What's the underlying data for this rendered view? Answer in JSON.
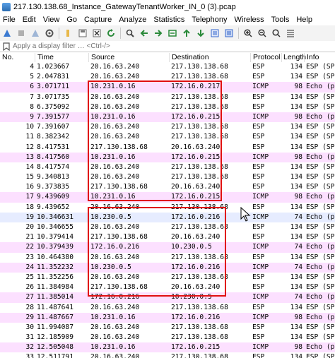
{
  "window": {
    "title": "217.130.138.68_Instance_GatewayTenantWorker_IN_0 (3).pcap"
  },
  "menu": [
    "File",
    "Edit",
    "View",
    "Go",
    "Capture",
    "Analyze",
    "Statistics",
    "Telephony",
    "Wireless",
    "Tools",
    "Help"
  ],
  "toolbar": {
    "icons": [
      "shark-fin-start-icon",
      "stop-icon",
      "restart-icon",
      "options-gear-icon",
      "open-folder-icon",
      "save-icon",
      "close-file-icon",
      "reload-icon",
      "find-icon",
      "back-arrow-icon",
      "forward-arrow-icon",
      "go-to-packet-icon",
      "first-packet-icon",
      "last-packet-icon",
      "autoscroll-icon",
      "colorize-icon",
      "zoom-in-icon",
      "zoom-out-icon",
      "normal-size-icon",
      "resize-columns-icon"
    ]
  },
  "filter": {
    "placeholder": "Apply a display filter … <Ctrl-/>"
  },
  "columns": {
    "no": "No.",
    "time": "Time",
    "source": "Source",
    "destination": "Destination",
    "protocol": "Protocol",
    "length": "Length",
    "info": "Info"
  },
  "colors": {
    "esp_row": "#ffffff",
    "icmp_row": "#fce0ff",
    "selected_row": "#e6ecff",
    "highlight_box": "#e01010"
  },
  "packets": [
    {
      "no": "4",
      "time": "1.023667",
      "src": "20.16.63.240",
      "dst": "217.130.138.68",
      "proto": "ESP",
      "len": "134",
      "info": "ESP (SPI",
      "kind": "esp"
    },
    {
      "no": "5",
      "time": "2.047831",
      "src": "20.16.63.240",
      "dst": "217.130.138.68",
      "proto": "ESP",
      "len": "134",
      "info": "ESP (SPI",
      "kind": "esp"
    },
    {
      "no": "6",
      "time": "3.071711",
      "src": "10.231.0.16",
      "dst": "172.16.0.217",
      "proto": "ICMP",
      "len": "98",
      "info": "Echo (p",
      "kind": "icmp"
    },
    {
      "no": "7",
      "time": "3.071735",
      "src": "20.16.63.240",
      "dst": "217.130.138.68",
      "proto": "ESP",
      "len": "134",
      "info": "ESP (SP",
      "kind": "esp"
    },
    {
      "no": "8",
      "time": "6.375092",
      "src": "20.16.63.240",
      "dst": "217.130.138.68",
      "proto": "ESP",
      "len": "134",
      "info": "ESP (SP",
      "kind": "esp"
    },
    {
      "no": "9",
      "time": "7.391577",
      "src": "10.231.0.16",
      "dst": "172.16.0.215",
      "proto": "ICMP",
      "len": "98",
      "info": "Echo (p",
      "kind": "icmp"
    },
    {
      "no": "10",
      "time": "7.391607",
      "src": "20.16.63.240",
      "dst": "217.130.138.68",
      "proto": "ESP",
      "len": "134",
      "info": "ESP (SP",
      "kind": "esp"
    },
    {
      "no": "11",
      "time": "8.382342",
      "src": "20.16.63.240",
      "dst": "217.130.138.68",
      "proto": "ESP",
      "len": "134",
      "info": "ESP (SP",
      "kind": "esp"
    },
    {
      "no": "12",
      "time": "8.417531",
      "src": "217.130.138.68",
      "dst": "20.16.63.240",
      "proto": "ESP",
      "len": "134",
      "info": "ESP (SP",
      "kind": "esp"
    },
    {
      "no": "13",
      "time": "8.417560",
      "src": "10.231.0.16",
      "dst": "172.16.0.215",
      "proto": "ICMP",
      "len": "98",
      "info": "Echo (p",
      "kind": "icmp"
    },
    {
      "no": "14",
      "time": "8.417574",
      "src": "20.16.63.240",
      "dst": "217.130.138.68",
      "proto": "ESP",
      "len": "134",
      "info": "ESP (SP",
      "kind": "esp"
    },
    {
      "no": "15",
      "time": "9.340813",
      "src": "20.16.63.240",
      "dst": "217.130.138.68",
      "proto": "ESP",
      "len": "134",
      "info": "ESP (SP",
      "kind": "esp"
    },
    {
      "no": "16",
      "time": "9.373835",
      "src": "217.130.138.68",
      "dst": "20.16.63.240",
      "proto": "ESP",
      "len": "134",
      "info": "ESP (SP",
      "kind": "esp"
    },
    {
      "no": "17",
      "time": "9.439609",
      "src": "10.231.0.16",
      "dst": "172.16.0.215",
      "proto": "ICMP",
      "len": "98",
      "info": "Echo (p",
      "kind": "icmp"
    },
    {
      "no": "18",
      "time": "9.439652",
      "src": "20.16.63.240",
      "dst": "217.130.138.68",
      "proto": "ESP",
      "len": "134",
      "info": "ESP (SP",
      "kind": "esp"
    },
    {
      "no": "19",
      "time": "10.346631",
      "src": "10.230.0.5",
      "dst": "172.16.0.216",
      "proto": "ICMP",
      "len": "74",
      "info": "Echo (p",
      "kind": "sel"
    },
    {
      "no": "20",
      "time": "10.346655",
      "src": "20.16.63.240",
      "dst": "217.130.138.68",
      "proto": "ESP",
      "len": "134",
      "info": "ESP (SP",
      "kind": "esp"
    },
    {
      "no": "21",
      "time": "10.379414",
      "src": "217.130.138.68",
      "dst": "20.16.63.240",
      "proto": "ESP",
      "len": "134",
      "info": "ESP (SP",
      "kind": "esp"
    },
    {
      "no": "22",
      "time": "10.379439",
      "src": "172.16.0.216",
      "dst": "10.230.0.5",
      "proto": "ICMP",
      "len": "74",
      "info": "Echo (p",
      "kind": "icmp"
    },
    {
      "no": "23",
      "time": "10.464380",
      "src": "20.16.63.240",
      "dst": "217.130.138.68",
      "proto": "ESP",
      "len": "134",
      "info": "ESP (SP",
      "kind": "esp"
    },
    {
      "no": "24",
      "time": "11.352232",
      "src": "10.230.0.5",
      "dst": "172.16.0.216",
      "proto": "ICMP",
      "len": "74",
      "info": "Echo (p",
      "kind": "icmp"
    },
    {
      "no": "25",
      "time": "11.352256",
      "src": "20.16.63.240",
      "dst": "217.130.138.68",
      "proto": "ESP",
      "len": "134",
      "info": "ESP (SP",
      "kind": "esp"
    },
    {
      "no": "26",
      "time": "11.384984",
      "src": "217.130.138.68",
      "dst": "20.16.63.240",
      "proto": "ESP",
      "len": "134",
      "info": "ESP (SP",
      "kind": "esp"
    },
    {
      "no": "27",
      "time": "11.385014",
      "src": "172.16.0.216",
      "dst": "10.230.0.5",
      "proto": "ICMP",
      "len": "74",
      "info": "Echo (p",
      "kind": "icmp"
    },
    {
      "no": "28",
      "time": "11.487641",
      "src": "20.16.63.240",
      "dst": "217.130.138.68",
      "proto": "ESP",
      "len": "134",
      "info": "ESP (SP",
      "kind": "esp"
    },
    {
      "no": "29",
      "time": "11.487667",
      "src": "10.231.0.16",
      "dst": "172.16.0.216",
      "proto": "ICMP",
      "len": "98",
      "info": "Echo (p",
      "kind": "icmp"
    },
    {
      "no": "30",
      "time": "11.994087",
      "src": "20.16.63.240",
      "dst": "217.130.138.68",
      "proto": "ESP",
      "len": "134",
      "info": "ESP (SP",
      "kind": "esp"
    },
    {
      "no": "31",
      "time": "12.185909",
      "src": "20.16.63.240",
      "dst": "217.130.138.68",
      "proto": "ESP",
      "len": "134",
      "info": "ESP (SP",
      "kind": "esp"
    },
    {
      "no": "32",
      "time": "12.505048",
      "src": "10.231.0.16",
      "dst": "172.16.0.215",
      "proto": "ICMP",
      "len": "98",
      "info": "Echo (p",
      "kind": "icmp"
    },
    {
      "no": "33",
      "time": "12.511791",
      "src": "20.16.63.240",
      "dst": "217.130.138.68",
      "proto": "ESP",
      "len": "134",
      "info": "ESP (SP",
      "kind": "esp"
    }
  ]
}
